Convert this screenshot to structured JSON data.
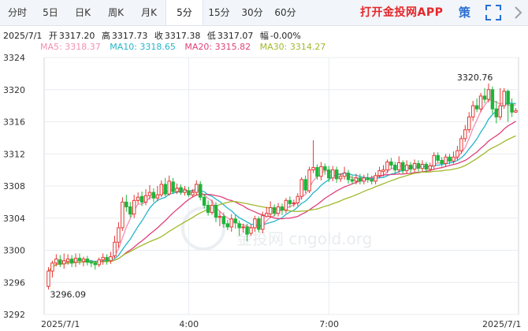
{
  "tabs": [
    {
      "label": "分时",
      "active": false
    },
    {
      "label": "5日",
      "active": false
    },
    {
      "label": "日K",
      "active": false
    },
    {
      "label": "周K",
      "active": false
    },
    {
      "label": "月K",
      "active": false
    },
    {
      "label": "5分",
      "active": true
    },
    {
      "label": "15分",
      "active": false
    },
    {
      "label": "30分",
      "active": false
    },
    {
      "label": "60分",
      "active": false
    }
  ],
  "promo_text": "打开金投网APP",
  "toolbar": {
    "strategy_label": "策",
    "fullscreen_icon": "fullscreen-icon"
  },
  "info": {
    "date": "2025/7/1",
    "open_label": "开",
    "open": "3317.20",
    "high_label": "高",
    "high": "3317.73",
    "close_label": "收",
    "close": "3317.38",
    "low_label": "低",
    "low": "3317.07",
    "change_label": "幅",
    "change": "-0.00%"
  },
  "ma": [
    {
      "label": "MA5: 3318.37",
      "color": "#f48fb1"
    },
    {
      "label": "MA10: 3318.65",
      "color": "#26b6cc"
    },
    {
      "label": "MA20: 3315.82",
      "color": "#e0407a"
    },
    {
      "label": "MA30: 3314.27",
      "color": "#a2b82b"
    }
  ],
  "watermark": "金投网 cngold.org",
  "colors": {
    "up": "#e53935",
    "down": "#1fb43a"
  },
  "chart_data": {
    "type": "candlestick",
    "y_ticks": [
      3292,
      3296,
      3300,
      3304,
      3308,
      3312,
      3316,
      3320,
      3324
    ],
    "ylim": [
      3292,
      3324
    ],
    "x_labels": [
      "2025/7/1",
      "4:00",
      "7:00",
      "2025/7/1"
    ],
    "x_label_index": [
      0,
      36,
      72,
      120
    ],
    "annotations": {
      "max": "3320.76",
      "min": "3296.09"
    },
    "candles": [
      [
        3295.5,
        3297.4,
        3297.9,
        3295.1
      ],
      [
        3297.4,
        3298.4,
        3298.7,
        3296.6
      ],
      [
        3298.4,
        3298.9,
        3299.5,
        3298.0
      ],
      [
        3298.8,
        3298.3,
        3299.4,
        3297.9
      ],
      [
        3298.3,
        3298.7,
        3299.6,
        3297.7
      ],
      [
        3298.6,
        3298.9,
        3299.5,
        3298.2
      ],
      [
        3298.9,
        3298.4,
        3299.4,
        3297.9
      ],
      [
        3298.5,
        3299.0,
        3299.6,
        3297.9
      ],
      [
        3299.0,
        3298.7,
        3299.6,
        3298.2
      ],
      [
        3298.6,
        3298.9,
        3299.2,
        3298.0
      ],
      [
        3298.9,
        3298.5,
        3299.3,
        3298.1
      ],
      [
        3298.5,
        3298.4,
        3298.8,
        3297.9
      ],
      [
        3298.4,
        3298.2,
        3298.7,
        3297.6
      ],
      [
        3298.2,
        3298.8,
        3299.1,
        3297.9
      ],
      [
        3298.8,
        3299.1,
        3299.6,
        3298.2
      ],
      [
        3299.1,
        3298.7,
        3299.5,
        3298.2
      ],
      [
        3298.7,
        3299.2,
        3299.8,
        3298.3
      ],
      [
        3299.3,
        3301.0,
        3301.8,
        3299.0
      ],
      [
        3301.0,
        3302.8,
        3303.5,
        3300.3
      ],
      [
        3302.8,
        3306.0,
        3306.6,
        3302.4
      ],
      [
        3306.0,
        3305.4,
        3306.9,
        3304.8
      ],
      [
        3305.4,
        3304.5,
        3306.0,
        3304.1
      ],
      [
        3304.5,
        3306.2,
        3306.9,
        3304.0
      ],
      [
        3306.2,
        3306.6,
        3307.2,
        3305.8
      ],
      [
        3306.7,
        3306.0,
        3307.3,
        3305.5
      ],
      [
        3306.0,
        3306.8,
        3307.6,
        3305.6
      ],
      [
        3306.8,
        3307.2,
        3308.1,
        3306.3
      ],
      [
        3307.2,
        3306.5,
        3307.7,
        3306.0
      ],
      [
        3306.5,
        3306.9,
        3308.0,
        3306.1
      ],
      [
        3306.9,
        3308.2,
        3308.7,
        3306.6
      ],
      [
        3308.2,
        3307.0,
        3309.0,
        3306.7
      ],
      [
        3307.0,
        3308.6,
        3309.3,
        3306.8
      ],
      [
        3308.5,
        3307.3,
        3309.0,
        3307.0
      ],
      [
        3307.3,
        3307.7,
        3308.3,
        3307.0
      ],
      [
        3307.8,
        3307.2,
        3308.2,
        3306.9
      ],
      [
        3307.2,
        3307.5,
        3308.0,
        3306.8
      ],
      [
        3307.4,
        3306.9,
        3307.9,
        3306.6
      ],
      [
        3306.9,
        3307.2,
        3307.6,
        3306.6
      ],
      [
        3307.2,
        3308.2,
        3308.7,
        3306.8
      ],
      [
        3308.2,
        3306.6,
        3308.6,
        3306.2
      ],
      [
        3306.6,
        3305.6,
        3307.0,
        3305.2
      ],
      [
        3305.6,
        3304.7,
        3306.2,
        3304.3
      ],
      [
        3304.7,
        3305.6,
        3306.3,
        3304.4
      ],
      [
        3305.6,
        3304.1,
        3306.0,
        3303.5
      ],
      [
        3304.1,
        3304.2,
        3304.9,
        3303.0
      ],
      [
        3304.2,
        3303.3,
        3304.7,
        3302.8
      ],
      [
        3303.3,
        3302.9,
        3303.8,
        3302.5
      ],
      [
        3302.9,
        3303.9,
        3304.5,
        3302.3
      ],
      [
        3303.9,
        3303.4,
        3304.4,
        3302.7
      ],
      [
        3303.3,
        3302.8,
        3303.7,
        3301.8
      ],
      [
        3302.8,
        3302.9,
        3303.3,
        3302.2
      ],
      [
        3302.9,
        3302.0,
        3303.3,
        3301.1
      ],
      [
        3302.1,
        3302.8,
        3303.2,
        3301.8
      ],
      [
        3302.8,
        3303.9,
        3304.3,
        3302.3
      ],
      [
        3303.9,
        3302.6,
        3304.2,
        3302.2
      ],
      [
        3302.6,
        3304.3,
        3304.8,
        3302.1
      ],
      [
        3304.2,
        3304.6,
        3305.4,
        3304.1
      ],
      [
        3304.5,
        3305.3,
        3306.1,
        3304.0
      ],
      [
        3305.3,
        3304.6,
        3305.7,
        3304.2
      ],
      [
        3304.6,
        3305.4,
        3305.9,
        3304.2
      ],
      [
        3305.4,
        3305.0,
        3305.8,
        3304.4
      ],
      [
        3305.0,
        3306.2,
        3306.5,
        3304.6
      ],
      [
        3306.2,
        3305.8,
        3306.7,
        3305.3
      ],
      [
        3305.8,
        3305.9,
        3306.3,
        3305.4
      ],
      [
        3305.9,
        3306.7,
        3307.1,
        3305.5
      ],
      [
        3306.7,
        3308.8,
        3309.1,
        3306.3
      ],
      [
        3308.8,
        3307.5,
        3309.3,
        3307.1
      ],
      [
        3307.4,
        3310.0,
        3310.4,
        3307.1
      ],
      [
        3310.0,
        3310.3,
        3313.7,
        3309.6
      ],
      [
        3310.3,
        3309.2,
        3310.7,
        3308.8
      ],
      [
        3309.2,
        3310.4,
        3311.0,
        3308.7
      ],
      [
        3310.4,
        3310.0,
        3310.8,
        3309.4
      ],
      [
        3310.0,
        3309.0,
        3310.5,
        3308.5
      ],
      [
        3309.0,
        3310.0,
        3310.5,
        3308.6
      ],
      [
        3310.0,
        3308.9,
        3310.4,
        3308.4
      ],
      [
        3308.9,
        3309.2,
        3309.6,
        3308.5
      ],
      [
        3309.2,
        3309.6,
        3310.4,
        3308.8
      ],
      [
        3309.6,
        3308.8,
        3310.0,
        3308.3
      ],
      [
        3308.8,
        3308.6,
        3309.3,
        3308.2
      ],
      [
        3308.6,
        3309.0,
        3309.5,
        3308.2
      ],
      [
        3309.0,
        3308.6,
        3309.5,
        3308.2
      ],
      [
        3308.6,
        3309.0,
        3309.4,
        3308.2
      ],
      [
        3309.0,
        3308.8,
        3309.6,
        3308.4
      ],
      [
        3308.8,
        3308.6,
        3309.3,
        3308.2
      ],
      [
        3308.6,
        3309.3,
        3309.7,
        3308.2
      ],
      [
        3309.3,
        3309.9,
        3310.4,
        3309.0
      ],
      [
        3309.8,
        3310.0,
        3310.6,
        3309.2
      ],
      [
        3310.0,
        3311.0,
        3311.3,
        3309.6
      ],
      [
        3311.0,
        3310.6,
        3311.5,
        3310.1
      ],
      [
        3310.6,
        3310.0,
        3311.0,
        3309.6
      ],
      [
        3310.0,
        3310.9,
        3311.7,
        3309.6
      ],
      [
        3310.9,
        3309.9,
        3311.2,
        3309.5
      ],
      [
        3309.9,
        3310.6,
        3311.2,
        3309.5
      ],
      [
        3310.6,
        3310.1,
        3311.0,
        3309.6
      ],
      [
        3310.1,
        3310.8,
        3311.3,
        3309.7
      ],
      [
        3310.8,
        3310.2,
        3311.2,
        3309.8
      ],
      [
        3310.2,
        3310.7,
        3311.2,
        3309.8
      ],
      [
        3310.7,
        3310.1,
        3311.0,
        3309.7
      ],
      [
        3310.1,
        3310.5,
        3310.9,
        3309.8
      ],
      [
        3310.5,
        3311.8,
        3312.2,
        3310.1
      ],
      [
        3311.8,
        3311.2,
        3312.2,
        3310.9
      ],
      [
        3311.2,
        3310.8,
        3311.6,
        3310.4
      ],
      [
        3310.8,
        3311.6,
        3312.0,
        3310.4
      ],
      [
        3311.6,
        3311.1,
        3312.0,
        3310.7
      ],
      [
        3311.1,
        3311.6,
        3312.3,
        3310.8
      ],
      [
        3311.6,
        3312.4,
        3313.0,
        3311.2
      ],
      [
        3312.4,
        3313.9,
        3314.3,
        3312.0
      ],
      [
        3313.9,
        3315.0,
        3315.6,
        3313.5
      ],
      [
        3315.0,
        3316.6,
        3317.2,
        3314.6
      ],
      [
        3316.6,
        3318.0,
        3318.6,
        3316.1
      ],
      [
        3318.0,
        3317.6,
        3318.9,
        3317.2
      ],
      [
        3317.6,
        3319.2,
        3319.6,
        3317.2
      ],
      [
        3319.2,
        3318.8,
        3320.2,
        3318.3
      ],
      [
        3318.8,
        3320.0,
        3320.76,
        3318.4
      ],
      [
        3320.0,
        3317.6,
        3320.4,
        3317.0
      ],
      [
        3317.6,
        3316.6,
        3318.6,
        3315.8
      ],
      [
        3316.6,
        3318.0,
        3320.2,
        3316.2
      ],
      [
        3318.0,
        3319.8,
        3320.2,
        3317.6
      ],
      [
        3319.8,
        3318.2,
        3320.0,
        3316.0
      ],
      [
        3318.2,
        3317.2,
        3318.9,
        3316.6
      ],
      [
        3317.2,
        3317.4,
        3317.7,
        3317.1
      ]
    ]
  }
}
